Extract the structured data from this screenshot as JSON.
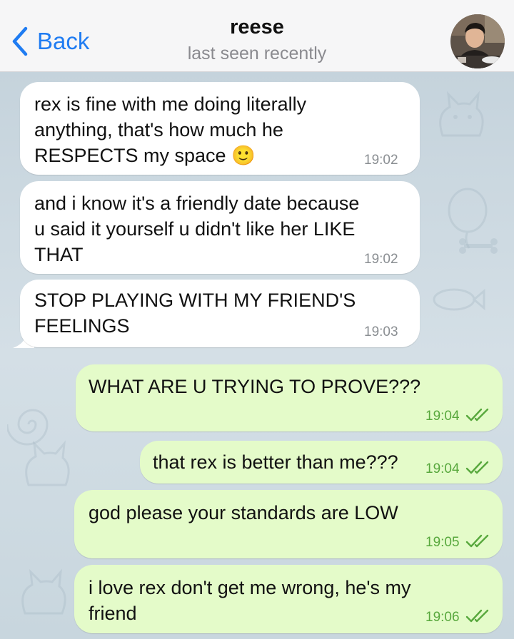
{
  "header": {
    "back_label": "Back",
    "contact_name": "reese",
    "status": "last seen recently"
  },
  "messages": [
    {
      "direction": "in",
      "lines": [
        "rex is fine with me doing literally",
        "anything, that's how much he",
        "RESPECTS my space 🙂"
      ],
      "time": "19:02"
    },
    {
      "direction": "in",
      "lines": [
        "and i know it's a friendly date because",
        "u said it yourself u didn't like her LIKE",
        "THAT"
      ],
      "time": "19:02"
    },
    {
      "direction": "in",
      "lines": [
        "STOP PLAYING WITH MY FRIEND'S",
        "FEELINGS"
      ],
      "time": "19:03"
    },
    {
      "direction": "out",
      "lines": [
        "WHAT ARE U TRYING TO PROVE???"
      ],
      "time": "19:04",
      "read": true
    },
    {
      "direction": "out",
      "lines": [
        "that rex is better than me???"
      ],
      "time": "19:04",
      "read": true
    },
    {
      "direction": "out",
      "lines": [
        "god please your standards are LOW"
      ],
      "time": "19:05",
      "read": true
    },
    {
      "direction": "out",
      "lines": [
        "i love rex don't get me wrong, he's my",
        "friend"
      ],
      "time": "19:06",
      "read": true
    }
  ],
  "icons": {
    "back": "chevron-left-icon",
    "read_receipt": "double-check-icon"
  },
  "colors": {
    "accent": "#1f7cf2",
    "incoming_bubble": "#ffffff",
    "outgoing_bubble": "#e4fbc9",
    "outgoing_time": "#58a83d"
  }
}
